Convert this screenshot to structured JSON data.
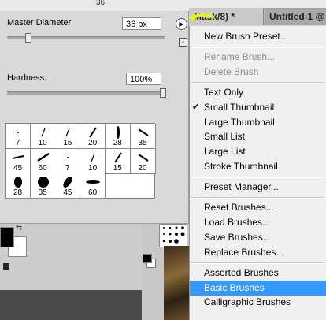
{
  "top_bar": {
    "size_readout": "36"
  },
  "tabs": [
    {
      "label": "Mask/8) *"
    },
    {
      "label": "Untitled-1 @ 5"
    }
  ],
  "brush_panel": {
    "master_diameter_label": "Master Diameter",
    "master_diameter_value": "36 px",
    "master_diameter_fraction": 0.13,
    "hardness_label": "Hardness:",
    "hardness_value": "100%",
    "hardness_fraction": 1.0,
    "brushes": [
      {
        "size": "7",
        "shape": "dot-small"
      },
      {
        "size": "10",
        "shape": "stroke-thin"
      },
      {
        "size": "15",
        "shape": "stroke-thin"
      },
      {
        "size": "20",
        "shape": "stroke-med"
      },
      {
        "size": "28",
        "shape": "leaf-tall"
      },
      {
        "size": "35",
        "shape": "stroke-diag"
      },
      {
        "size": "45",
        "shape": "stroke-flat"
      },
      {
        "size": "60",
        "shape": "stroke-long"
      },
      {
        "size": "7",
        "shape": "dot-small"
      },
      {
        "size": "10",
        "shape": "stroke-thin"
      },
      {
        "size": "15",
        "shape": "stroke-med"
      },
      {
        "size": "20",
        "shape": "stroke-diag"
      },
      {
        "size": "28",
        "shape": "blob"
      },
      {
        "size": "35",
        "shape": "blob-big"
      },
      {
        "size": "45",
        "shape": "leaf-big"
      },
      {
        "size": "60",
        "shape": "stroke-wide"
      }
    ]
  },
  "menu": {
    "items": [
      {
        "label": "New Brush Preset...",
        "disabled": false,
        "checked": false,
        "selected": false
      },
      {
        "sep": true
      },
      {
        "label": "Rename Brush...",
        "disabled": true,
        "checked": false,
        "selected": false
      },
      {
        "label": "Delete Brush",
        "disabled": true,
        "checked": false,
        "selected": false
      },
      {
        "sep": true
      },
      {
        "label": "Text Only",
        "disabled": false,
        "checked": false,
        "selected": false
      },
      {
        "label": "Small Thumbnail",
        "disabled": false,
        "checked": true,
        "selected": false
      },
      {
        "label": "Large Thumbnail",
        "disabled": false,
        "checked": false,
        "selected": false
      },
      {
        "label": "Small List",
        "disabled": false,
        "checked": false,
        "selected": false
      },
      {
        "label": "Large List",
        "disabled": false,
        "checked": false,
        "selected": false
      },
      {
        "label": "Stroke Thumbnail",
        "disabled": false,
        "checked": false,
        "selected": false
      },
      {
        "sep": true
      },
      {
        "label": "Preset Manager...",
        "disabled": false,
        "checked": false,
        "selected": false
      },
      {
        "sep": true
      },
      {
        "label": "Reset Brushes...",
        "disabled": false,
        "checked": false,
        "selected": false
      },
      {
        "label": "Load Brushes...",
        "disabled": false,
        "checked": false,
        "selected": false
      },
      {
        "label": "Save Brushes...",
        "disabled": false,
        "checked": false,
        "selected": false
      },
      {
        "label": "Replace Brushes...",
        "disabled": false,
        "checked": false,
        "selected": false
      },
      {
        "sep": true
      },
      {
        "label": "Assorted Brushes",
        "disabled": false,
        "checked": false,
        "selected": false
      },
      {
        "label": "Basic Brushes",
        "disabled": false,
        "checked": false,
        "selected": true
      },
      {
        "label": "Calligraphic Brushes",
        "disabled": false,
        "checked": false,
        "selected": false
      }
    ],
    "checkmark": "✔"
  },
  "colors": {
    "accent": "#3399ff",
    "annotation_arrow": "#e8f020"
  },
  "icons": {
    "menu_button": "flyout-arrow-icon",
    "new_preset": "new-preset-icon",
    "swap": "swap-colors-icon"
  }
}
